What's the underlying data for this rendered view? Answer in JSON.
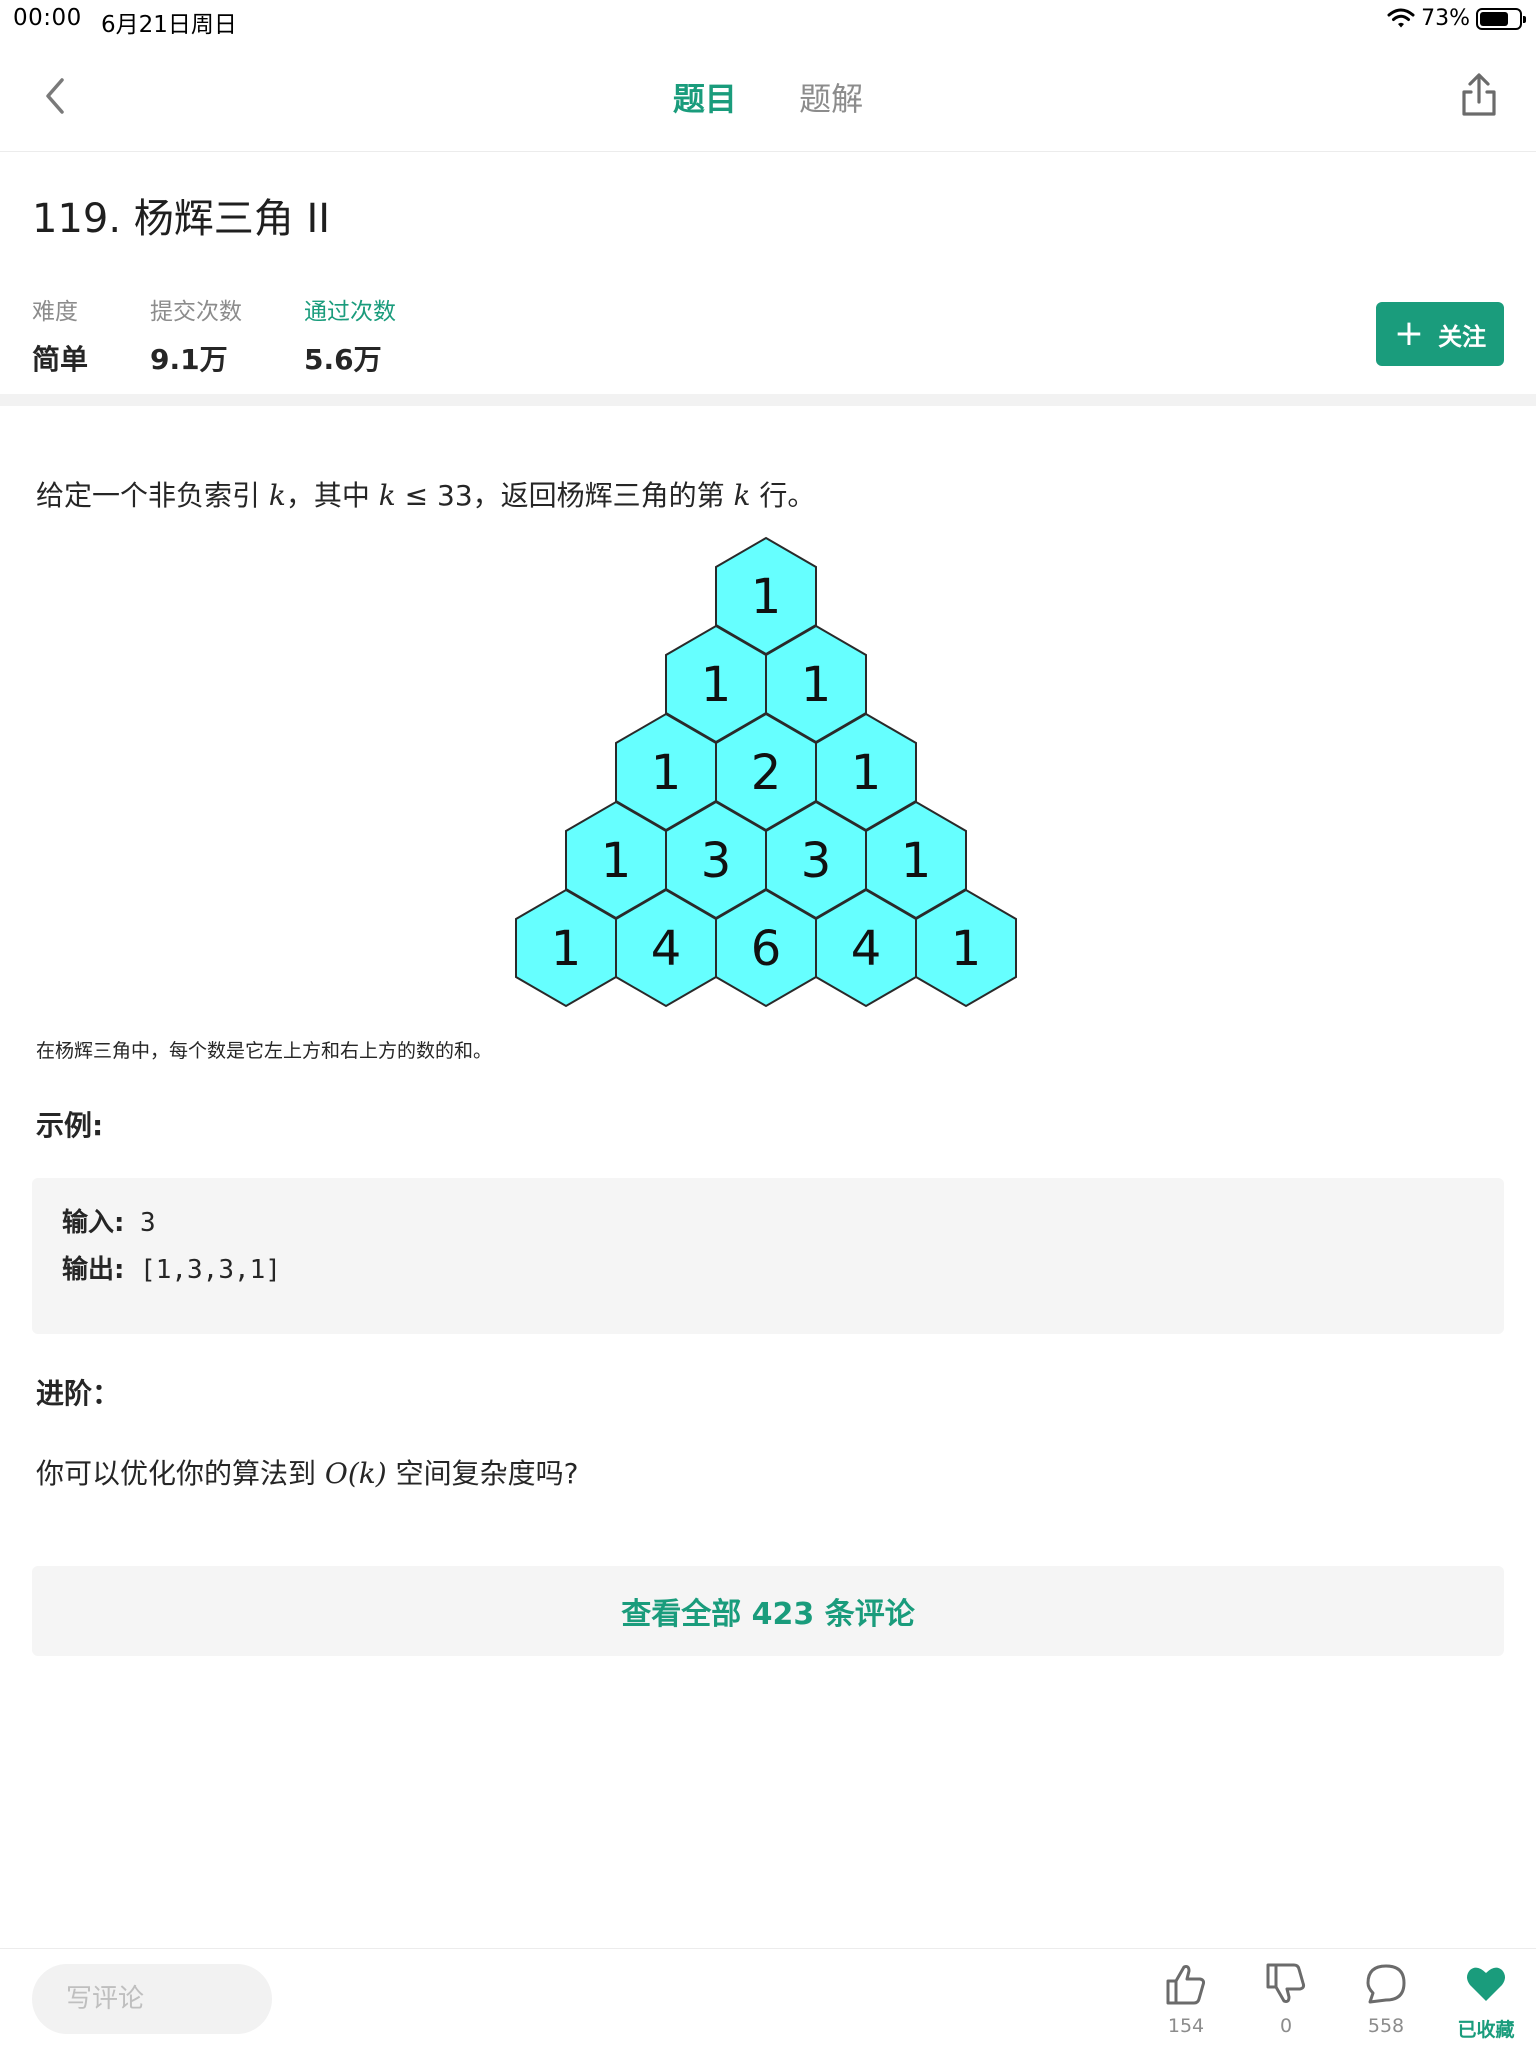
{
  "status_bar": {
    "time": "00:00",
    "date": "6月21日周日",
    "battery": "73%",
    "battery_level": 0.73
  },
  "nav": {
    "tabs": [
      {
        "label": "题目",
        "active": true
      },
      {
        "label": "题解",
        "active": false
      }
    ]
  },
  "problem": {
    "title": "119. 杨辉三角 II",
    "stats": [
      {
        "label": "难度",
        "value": "简单",
        "highlight": false
      },
      {
        "label": "提交次数",
        "value": "9.1万",
        "highlight": false
      },
      {
        "label": "通过次数",
        "value": "5.6万",
        "highlight": true
      }
    ],
    "follow_label": "关注"
  },
  "description": {
    "part1": "给定一个非负索引 ",
    "var_k": "k",
    "part2": "，其中 ",
    "part3": " ≤ 33，返回杨辉三角的第 ",
    "part4": " 行。"
  },
  "triangle_rows": [
    [
      1
    ],
    [
      1,
      1
    ],
    [
      1,
      2,
      1
    ],
    [
      1,
      3,
      3,
      1
    ],
    [
      1,
      4,
      6,
      4,
      1
    ]
  ],
  "caption": "在杨辉三角中，每个数是它左上方和右上方的数的和。",
  "example": {
    "title": "示例:",
    "input_label": "输入:",
    "input_value": " 3",
    "output_label": "输出:",
    "output_value": " [1,3,3,1]"
  },
  "advanced": {
    "title": "进阶：",
    "part1": "你可以优化你的算法到 ",
    "complexity": "O(k)",
    "part2": " 空间复杂度吗?"
  },
  "comments_button": "查看全部 423 条评论",
  "bottom_bar": {
    "comment_placeholder": "写评论",
    "actions": [
      {
        "icon": "thumbs-up-icon",
        "count": "154"
      },
      {
        "icon": "thumbs-down-icon",
        "count": "0"
      },
      {
        "icon": "comment-icon",
        "count": "558"
      },
      {
        "icon": "heart-icon",
        "label": "已收藏"
      }
    ]
  },
  "colors": {
    "accent": "#1a9c7c",
    "hex_fill": "#66ffff",
    "hex_stroke": "#2a2a2a"
  }
}
